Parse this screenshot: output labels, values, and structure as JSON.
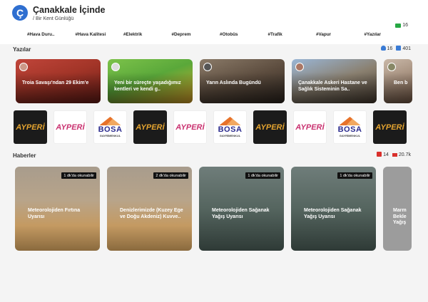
{
  "header": {
    "logo_letter": "Ç",
    "title": "Çanakkale İçinde",
    "subtitle_prefix": "/",
    "subtitle": "Bir Kent Günlüğü",
    "live_count": "16"
  },
  "tags": [
    "#Hava Duru..",
    "#Hava Kalitesi",
    "#Elektrik",
    "#Deprem",
    "#Otobüs",
    "#Trafik",
    "#Vapur",
    "#Yazılar"
  ],
  "articles": {
    "title": "Yazılar",
    "authors_count": "16",
    "posts_count": "401",
    "items": [
      {
        "title": "Troia Savaşı'ndan 29 Ekim'e"
      },
      {
        "title": "Yeni bir süreçte yaşadığımız kentleri ve kendi g.."
      },
      {
        "title": "Yarın Aslında Bugündü"
      },
      {
        "title": "Çanakkale Askeri Hastane ve Sağlık Sisteminin Sa.."
      },
      {
        "title": "Ben b"
      }
    ]
  },
  "ads": [
    {
      "type": "dark",
      "text": "AYPERİ"
    },
    {
      "type": "white",
      "text": "AYPERİ"
    },
    {
      "type": "bosa",
      "text": "BOSA",
      "sub": "GAYRİMENKUL"
    },
    {
      "type": "dark",
      "text": "AYPERİ"
    },
    {
      "type": "white",
      "text": "AYPERİ"
    },
    {
      "type": "bosa",
      "text": "BOSA",
      "sub": "GAYRİMENKUL"
    },
    {
      "type": "dark",
      "text": "AYPERİ"
    },
    {
      "type": "white",
      "text": "AYPERİ"
    },
    {
      "type": "bosa",
      "text": "BOSA",
      "sub": "GAYRİMENKUL"
    },
    {
      "type": "dark",
      "text": "AYPERİ"
    }
  ],
  "news": {
    "title": "Haberler",
    "categories_count": "14",
    "items_count": "20.7k",
    "items": [
      {
        "badge": "1 dk'da okunabilir",
        "title": "Meteorolojiden Fırtına Uyarısı",
        "style": "wheat"
      },
      {
        "badge": "2 dk'da okunabilir",
        "title": "Denizlerimizde (Kuzey Ege ve Doğu Akdeniz) Kuvve..",
        "style": "wheat"
      },
      {
        "badge": "1 dk'da okunabilir",
        "title": "Meteorolojiden Sağanak Yağış Uyarısı",
        "style": "rain"
      },
      {
        "badge": "1 dk'da okunabilir",
        "title": "Meteorolojiden Sağanak Yağış Uyarısı",
        "style": "rain"
      },
      {
        "badge": "",
        "title": "Marm Bekle Yağış",
        "style": "gray"
      }
    ]
  },
  "colors": {
    "accent": "#2f6fd0",
    "live": "#27a844",
    "news_icon": "#d9302c"
  }
}
